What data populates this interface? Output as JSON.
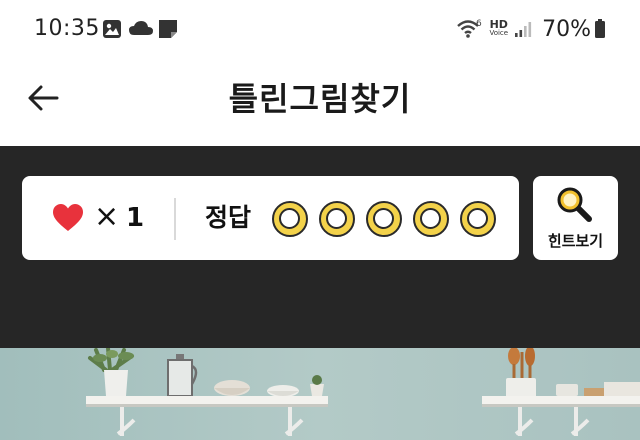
{
  "status_bar": {
    "time": "10:35",
    "icons": [
      "gallery-icon",
      "cloud-icon",
      "note-icon"
    ],
    "right_icons": [
      "wifi-6-icon",
      "hd-voice-icon",
      "signal-icon",
      "battery-icon"
    ],
    "hd_label": "HD",
    "voice_label": "Voice",
    "battery": "70%"
  },
  "app_bar": {
    "back_icon": "back-arrow-icon",
    "title": "틀린그림찾기"
  },
  "game": {
    "lives_icon": "heart-icon",
    "times_sign": "×",
    "lives_count": "1",
    "answer_label": "정답",
    "answer_slots": 5,
    "hint_label": "힌트보기",
    "hint_icon": "magnifier-icon"
  },
  "colors": {
    "panel_bg": "#262626",
    "heart": "#e8323c",
    "slot_ring": "#f3d24a",
    "magnifier": "#f2c12e",
    "wall": "#a8c2c0"
  }
}
